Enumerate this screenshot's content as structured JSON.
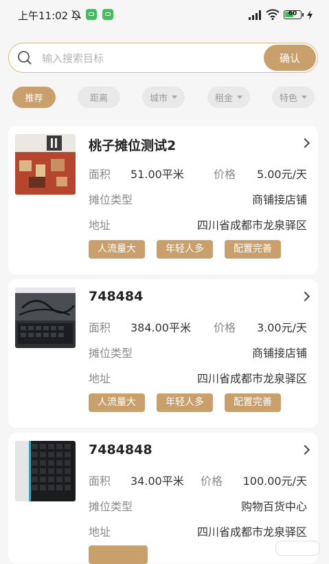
{
  "status_bar": {
    "time": "上午11:02",
    "battery": "60"
  },
  "search": {
    "placeholder": "输入搜索目标",
    "confirm_label": "确认"
  },
  "filters": [
    {
      "label": "推荐",
      "active": true,
      "dropdown": false
    },
    {
      "label": "距离",
      "active": false,
      "dropdown": false
    },
    {
      "label": "城市",
      "active": false,
      "dropdown": true
    },
    {
      "label": "租金",
      "active": false,
      "dropdown": true
    },
    {
      "label": "特色",
      "active": false,
      "dropdown": true
    }
  ],
  "listings": [
    {
      "title": "桃子摊位测试2",
      "area_label": "面积",
      "area": "51.00平米",
      "price_label": "价格",
      "price": "5.00元/天",
      "type_label": "摊位类型",
      "type": "商铺接店铺",
      "address_label": "地址",
      "address": "四川省成都市龙泉驿区",
      "tags": [
        "人流量大",
        "年轻人多",
        "配置完善"
      ]
    },
    {
      "title": "748484",
      "area_label": "面积",
      "area": "384.00平米",
      "price_label": "价格",
      "price": "3.00元/天",
      "type_label": "摊位类型",
      "type": "商铺接店铺",
      "address_label": "地址",
      "address": "四川省成都市龙泉驿区",
      "tags": [
        "人流量大",
        "年轻人多",
        "配置完善"
      ]
    },
    {
      "title": "7484848",
      "area_label": "面积",
      "area": "34.00平米",
      "price_label": "价格",
      "price": "100.00元/天",
      "type_label": "摊位类型",
      "type": "购物百货中心",
      "address_label": "地址",
      "address": "四川省成都市龙泉驿区",
      "tags": []
    }
  ],
  "colors": {
    "accent": "#c9a06c",
    "background": "#f6f6f6",
    "card": "#ffffff"
  },
  "icons": [
    "bell-off-icon",
    "app-icon",
    "signal-icon",
    "wifi-icon",
    "battery-icon",
    "charging-icon",
    "search-icon",
    "chevron-right-icon",
    "dropdown-caret-icon"
  ]
}
